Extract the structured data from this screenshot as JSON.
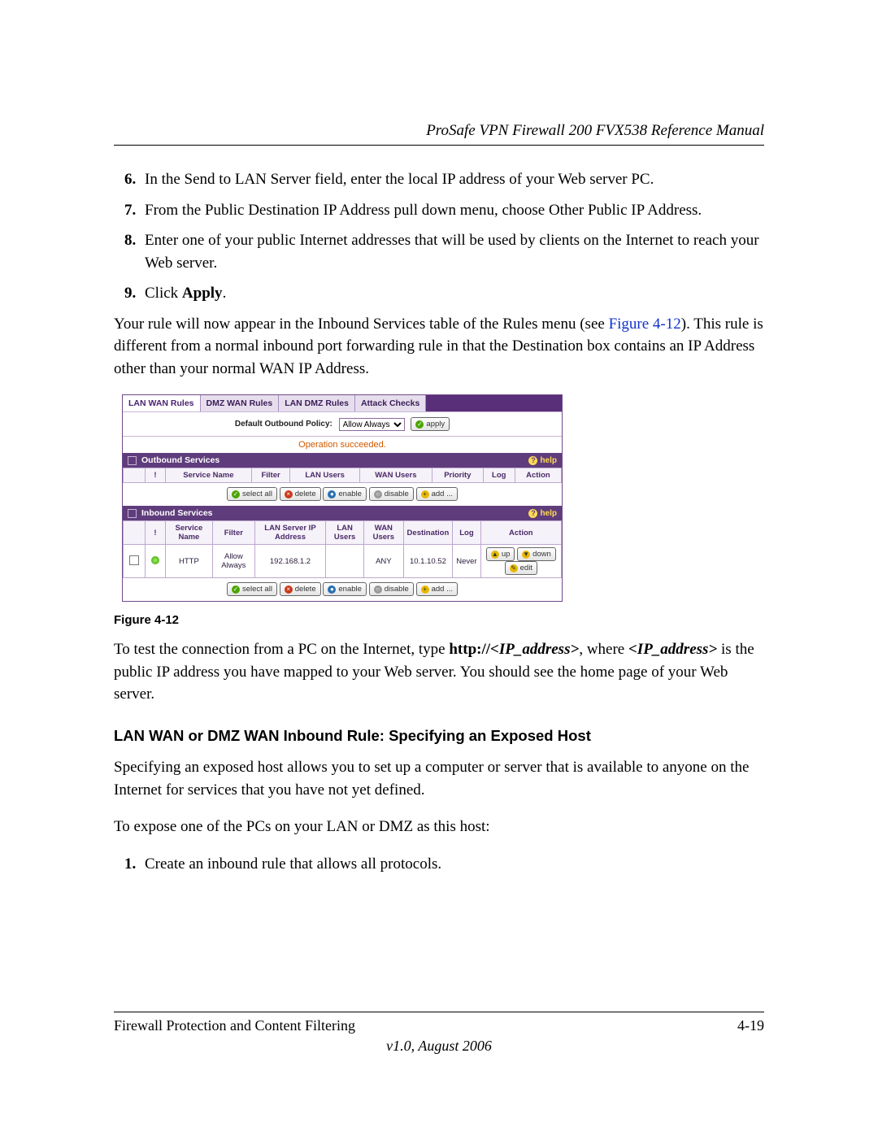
{
  "header": {
    "title": "ProSafe VPN Firewall 200 FVX538 Reference Manual"
  },
  "steps": {
    "s6": "In the Send to LAN Server field, enter the local IP address of your Web server PC.",
    "s7": "From the Public Destination IP Address pull down menu, choose Other Public IP Address.",
    "s8": "Enter one of your public Internet addresses that will be used by clients on the Internet to reach your Web server.",
    "s9_pre": "Click ",
    "s9_bold": "Apply",
    "s9_post": "."
  },
  "para1_pre": "Your rule will now appear in the Inbound Services table of the Rules menu (see ",
  "para1_link": "Figure 4-12",
  "para1_post": "). This rule is different from a normal inbound port forwarding rule in that the Destination box contains an IP Address other than your normal WAN IP Address.",
  "figure_caption": "Figure 4-12",
  "para2_pre": "To test the connection from a PC on the Internet, type ",
  "para2_b1": "http://",
  "para2_bi1": "<IP_address>",
  "para2_mid": ", where ",
  "para2_bi2": "<IP_address>",
  "para2_post": " is the public IP address you have mapped to your Web server. You should see the home page of your Web server.",
  "subhead": "LAN WAN or DMZ WAN Inbound Rule: Specifying an Exposed Host",
  "para3": "Specifying an exposed host allows you to set up a computer or server that is available to anyone on the Internet for services that you have not yet defined.",
  "para4": "To expose one of the PCs on your LAN or DMZ as this host:",
  "step1": "Create an inbound rule that allows all protocols.",
  "screenshot": {
    "tabs": {
      "t1": "LAN WAN Rules",
      "t2": "DMZ WAN Rules",
      "t3": "LAN DMZ Rules",
      "t4": "Attack Checks"
    },
    "policy_label": "Default Outbound Policy:",
    "policy_value": "Allow Always",
    "apply": "apply",
    "status": "Operation succeeded.",
    "outbound_title": "Outbound Services",
    "inbound_title": "Inbound Services",
    "help": "help",
    "out_cols": {
      "c1": "!",
      "c2": "Service Name",
      "c3": "Filter",
      "c4": "LAN Users",
      "c5": "WAN Users",
      "c6": "Priority",
      "c7": "Log",
      "c8": "Action"
    },
    "in_cols": {
      "c1": "!",
      "c2": "Service Name",
      "c3": "Filter",
      "c4": "LAN Server IP Address",
      "c5": "LAN Users",
      "c6": "WAN Users",
      "c7": "Destination",
      "c8": "Log",
      "c9": "Action"
    },
    "in_row": {
      "service": "HTTP",
      "filter": "Allow Always",
      "lansrv": "192.168.1.2",
      "lanusers": "",
      "wanusers": "ANY",
      "dest": "10.1.10.52",
      "log": "Never"
    },
    "btns": {
      "selectall": "select all",
      "delete": "delete",
      "enable": "enable",
      "disable": "disable",
      "add": "add ...",
      "up": "up",
      "down": "down",
      "edit": "edit"
    }
  },
  "footer": {
    "left": "Firewall Protection and Content Filtering",
    "right": "4-19",
    "center": "v1.0, August 2006"
  }
}
